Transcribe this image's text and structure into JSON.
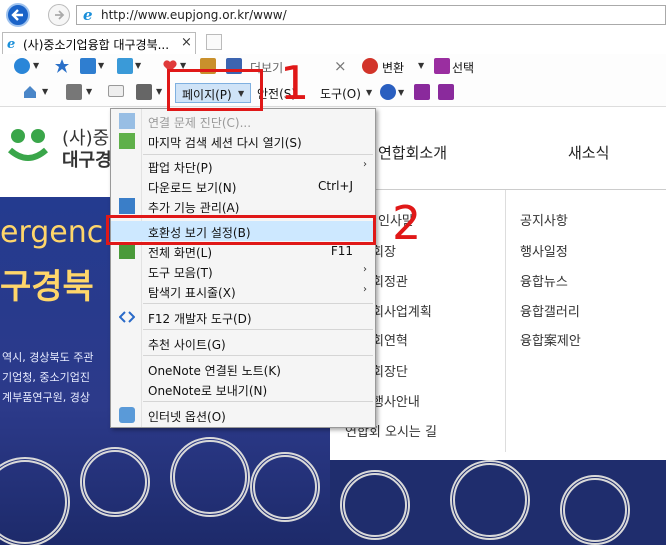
{
  "browser": {
    "url": "http://www.eupjong.or.kr/www/",
    "tab_title": "(사)중소기업융합 대구경북...",
    "tab_close": "×"
  },
  "toolbar": {
    "more_label": "더보기",
    "close_x": "×",
    "translate_label": "변환",
    "select_label": "선택",
    "page_label": "페이지(P)",
    "safety_label": "안전(S)",
    "tools_label": "도구(O)"
  },
  "site": {
    "logo_line1": "(사)중.",
    "logo_line2": "대구경",
    "nav_about": "연합회소개",
    "nav_news": "새소식",
    "hero_line1": "ergenc",
    "hero_line2": "구경북",
    "hero_small1": "역시, 경상북도  주관",
    "hero_small2": "기업청, 중소기업진",
    "hero_small3": "계부품연구원, 경상",
    "sub_left": [
      "인사말",
      "회장",
      "회정관",
      "회사업계획",
      "회연혁",
      "회장단",
      "행사안내",
      "연합회 오시는 길"
    ],
    "sub_right": [
      "공지사항",
      "행사일정",
      "융합뉴스",
      "융합갤러리",
      "융합案제안"
    ]
  },
  "menu": {
    "items": [
      {
        "label": "연결 문제 진단(C)...",
        "shortcut": "",
        "arrow": false,
        "disabled": true
      },
      {
        "label": "마지막 검색 세션 다시 열기(S)",
        "shortcut": "",
        "arrow": false
      },
      {
        "label": "팝업 차단(P)",
        "shortcut": "",
        "arrow": true
      },
      {
        "label": "다운로드 보기(N)",
        "shortcut": "Ctrl+J",
        "arrow": false
      },
      {
        "label": "추가 기능 관리(A)",
        "shortcut": "",
        "arrow": false
      },
      {
        "label": "호환성 보기 설정(B)",
        "shortcut": "",
        "arrow": false,
        "highlighted": true
      },
      {
        "label": "전체 화면(L)",
        "shortcut": "F11",
        "arrow": false
      },
      {
        "label": "도구 모음(T)",
        "shortcut": "",
        "arrow": true
      },
      {
        "label": "탐색기 표시줄(X)",
        "shortcut": "",
        "arrow": true
      },
      {
        "label": "F12 개발자 도구(D)",
        "shortcut": "",
        "arrow": false
      },
      {
        "label": "추천 사이트(G)",
        "shortcut": "",
        "arrow": false
      },
      {
        "label": "OneNote 연결된 노트(K)",
        "shortcut": "",
        "arrow": false
      },
      {
        "label": "OneNote로 보내기(N)",
        "shortcut": "",
        "arrow": false
      },
      {
        "label": "인터넷 옵션(O)",
        "shortcut": "",
        "arrow": false
      }
    ],
    "arrow_glyph": "›"
  },
  "annotations": {
    "step1": "1",
    "step2": "2",
    "color": "#e01818"
  },
  "icons": {
    "back": "back-arrow-icon",
    "forward": "forward-arrow-icon",
    "ie": "ie-logo-icon",
    "home": "home-icon",
    "rss": "rss-feed-icon",
    "mail": "mail-icon",
    "print": "print-icon",
    "help": "help-icon"
  },
  "colors": {
    "accent": "#1a63c8",
    "highlight": "#cde8ff",
    "hero": "#243b8f",
    "hero_text": "#ffd66a"
  }
}
